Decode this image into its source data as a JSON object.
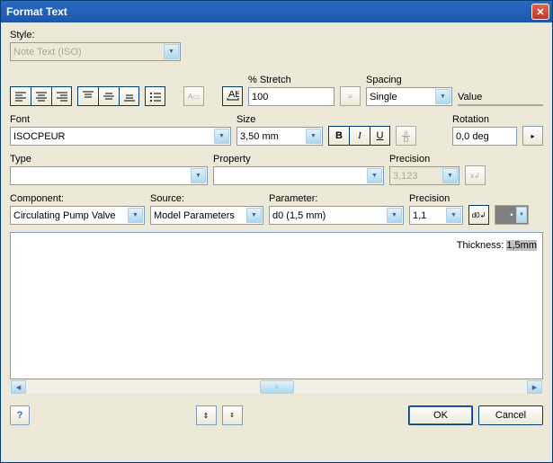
{
  "window": {
    "title": "Format Text"
  },
  "style": {
    "label": "Style:",
    "value": "Note Text (ISO)"
  },
  "stretch": {
    "label": "% Stretch",
    "value": "100"
  },
  "spacing": {
    "label": "Spacing",
    "value": "Single"
  },
  "value": {
    "label": "Value"
  },
  "font": {
    "label": "Font",
    "value": "ISOCPEUR"
  },
  "size": {
    "label": "Size",
    "value": "3,50 mm"
  },
  "rotation": {
    "label": "Rotation",
    "value": "0,0 deg"
  },
  "type": {
    "label": "Type",
    "value": ""
  },
  "property": {
    "label": "Property",
    "value": ""
  },
  "precision1": {
    "label": "Precision",
    "value": "3,123"
  },
  "component": {
    "label": "Component:",
    "value": "Circulating Pump Valve"
  },
  "source": {
    "label": "Source:",
    "value": "Model Parameters"
  },
  "parameter": {
    "label": "Parameter:",
    "value": "d0 (1,5 mm)"
  },
  "precision2": {
    "label": "Precision",
    "value": "1,1"
  },
  "textarea": {
    "prefix": "Thickness: ",
    "highlight": "1,5mm"
  },
  "buttons": {
    "ok": "OK",
    "cancel": "Cancel"
  }
}
